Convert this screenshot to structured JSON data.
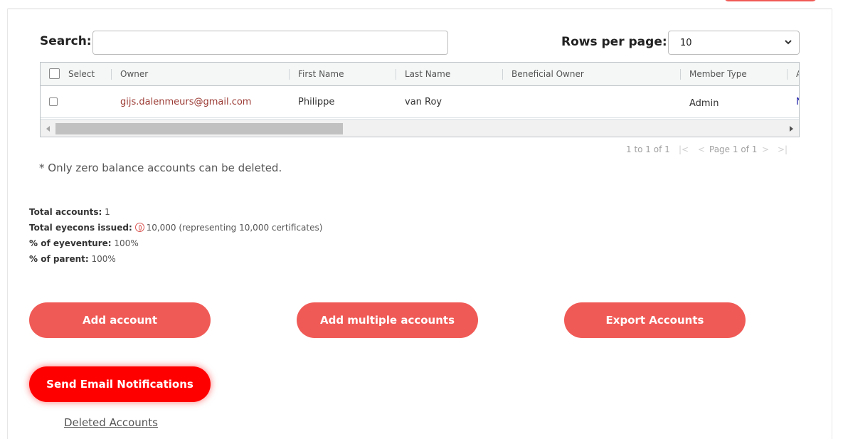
{
  "search": {
    "label": "Search:",
    "value": "",
    "placeholder": ""
  },
  "rows_per_page": {
    "label": "Rows per page:",
    "selected": "10"
  },
  "grid": {
    "headers": [
      "Select",
      "Owner",
      "First Name",
      "Last Name",
      "Beneficial Owner",
      "Member Type",
      "A"
    ],
    "rows": [
      {
        "owner": "gijs.dalenmeurs@gmail.com",
        "first_name": "Philippe",
        "last_name": "van Roy",
        "beneficial_owner": "",
        "member_type": "Admin",
        "next": "N"
      }
    ]
  },
  "pagination": {
    "range": "1 to 1 of 1",
    "page": "Page 1 of 1",
    "first": "|<",
    "prev": "<",
    "next": ">",
    "last": ">|"
  },
  "note": "* Only zero balance accounts can be deleted.",
  "stats": {
    "total_accounts_label": "Total accounts:",
    "total_accounts_value": "1",
    "total_eyecons_label": "Total eyecons issued:",
    "total_eyecons_value": "10,000 (representing 10,000 certificates)",
    "pct_eyeventure_label": "% of eyeventure:",
    "pct_eyeventure_value": "100%",
    "pct_parent_label": "% of parent:",
    "pct_parent_value": "100%"
  },
  "buttons": {
    "add_account": "Add account",
    "add_multiple": "Add multiple accounts",
    "export": "Export Accounts",
    "send_email": "Send Email Notifications"
  },
  "deleted_link": "Deleted Accounts",
  "colors": {
    "accent": "#f05a56",
    "primary": "#ff0000",
    "link": "#9b3a34"
  }
}
